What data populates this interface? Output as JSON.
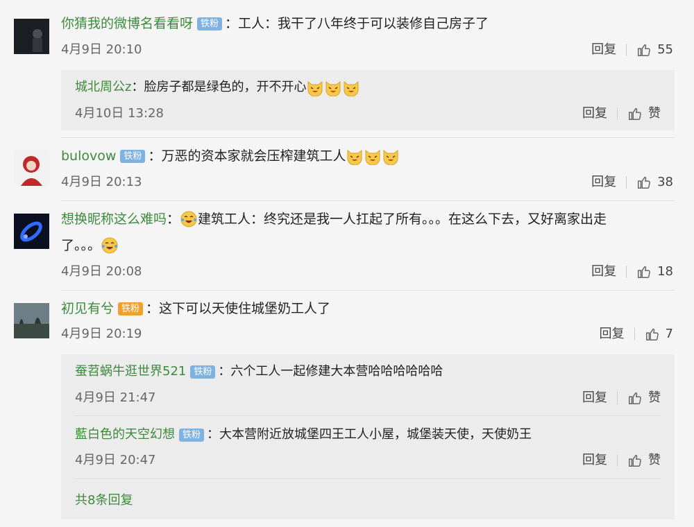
{
  "comments": [
    {
      "user": "你猜我的微博名看看呀",
      "badge": "",
      "text": "：工人：我干了八年终于可以装修自己房子了",
      "time": "4月9日 20:10",
      "reply": "回复",
      "likes": "55",
      "replies": [
        {
          "user": "城北周公z",
          "text": "：脸房子都是绿色的，开不开心",
          "time": "4月10日 13:28",
          "reply": "回复",
          "like": "赞"
        }
      ]
    },
    {
      "user": "bulovow",
      "badge": "铁粉",
      "text": "：万恶的资本家就会压榨建筑工人",
      "time": "4月9日 20:13",
      "reply": "回复",
      "likes": "38"
    },
    {
      "user": "想换昵称这么难吗",
      "text": "：",
      "text2": "建筑工人：终究还是我一人扛起了所有。。。在这么下去，又好离家出走",
      "text3": "了。。。",
      "time": "4月9日 20:08",
      "reply": "回复",
      "likes": "18"
    },
    {
      "user": "初见有兮",
      "badge": "铁粉",
      "text": "：这下可以天使住城堡奶工人了",
      "time": "4月9日 20:19",
      "reply": "回复",
      "likes": "7",
      "replies": [
        {
          "user": "蚕苕蜗牛逛世界521",
          "badge": "铁粉",
          "text": "：六个工人一起修建大本营哈哈哈哈哈哈",
          "time": "4月9日 21:47",
          "reply": "回复",
          "like": "赞"
        },
        {
          "user": "藍白色的天空幻想",
          "badge": "铁粉",
          "text": "：大本营附近放城堡四王工人小屋，城堡装天使，天使奶王",
          "time": "4月9日 20:47",
          "reply": "回复",
          "like": "赞"
        }
      ],
      "more": "共8条回复"
    }
  ],
  "colors": {
    "username": "#3d8a3d",
    "badge": "#7fb2e0",
    "badge_gold": "#f0a030",
    "background": "#f5f5f5",
    "reply_bg": "#ececec"
  },
  "icons": [
    "thumbs-up-icon",
    "laughing-cat-emoji",
    "crying-laugh-emoji"
  ]
}
